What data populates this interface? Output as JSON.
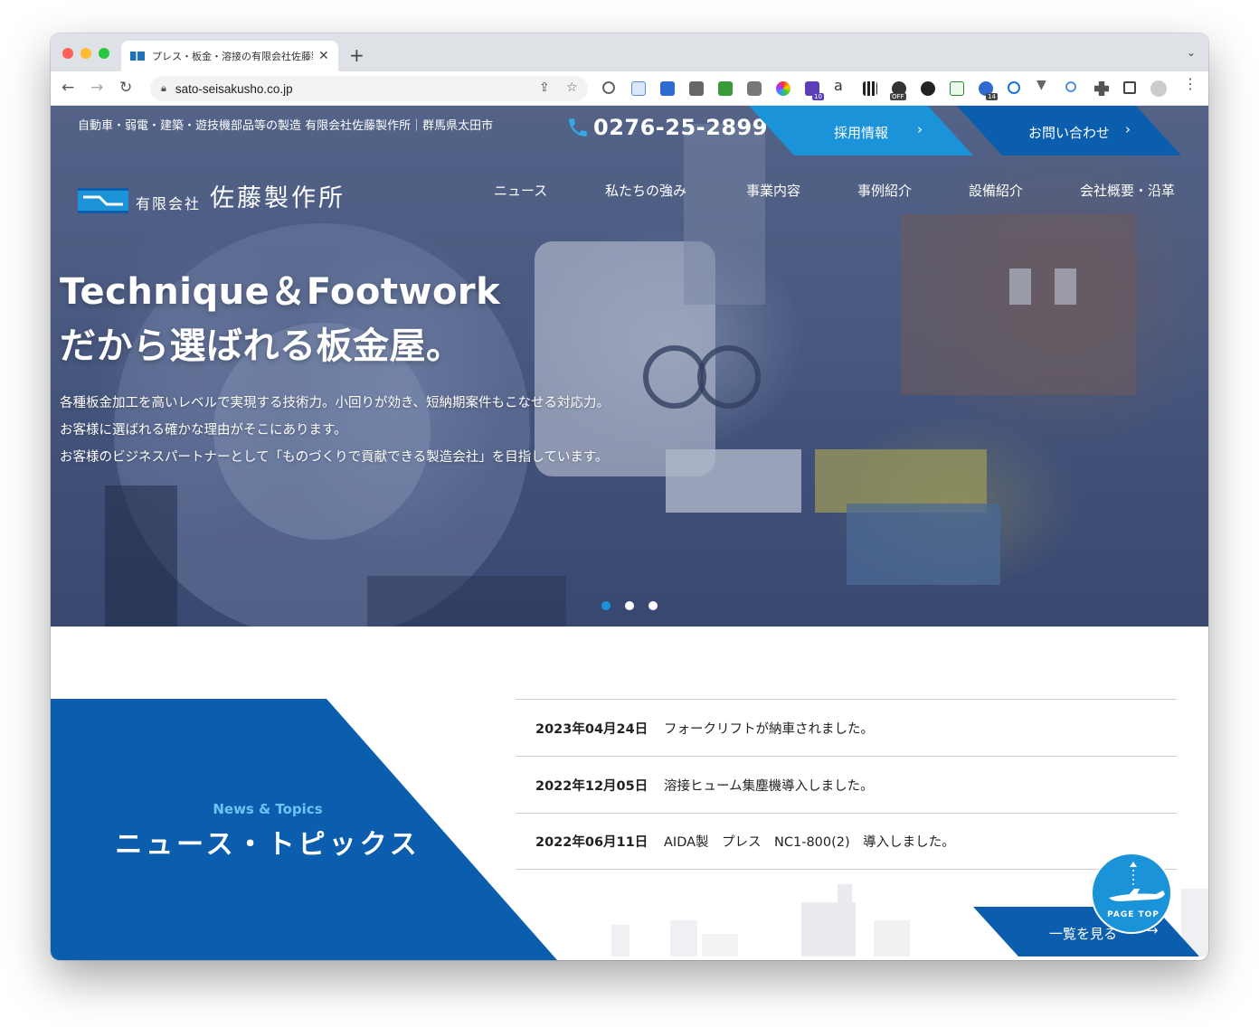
{
  "browser": {
    "tab_title": "プレス・板金・溶接の有限会社佐藤製作所",
    "url": "sato-seisakusho.co.jp",
    "extension_badges": {
      "mail": "10",
      "off": "OFF",
      "sync": "14"
    }
  },
  "header": {
    "info": "自動車・弱電・建築・遊技機部品等の製造 有限会社佐藤製作所｜群馬県太田市",
    "phone": "0276-25-2899",
    "recruit_label": "採用情報",
    "contact_label": "お問い合わせ",
    "logo_prefix": "有限会社",
    "logo_name": "佐藤製作所"
  },
  "nav": [
    "ニュース",
    "私たちの強み",
    "事業内容",
    "事例紹介",
    "設備紹介",
    "会社概要・沿革"
  ],
  "hero": {
    "title_line1": "Technique＆Footwork",
    "title_line2": "だから選ばれる板金屋。",
    "body": [
      "各種板金加工を高いレベルで実現する技術力。小回りが効き、短納期案件もこなせる対応力。",
      "お客様に選ばれる確かな理由がそこにあります。",
      "お客様のビジネスパートナーとして「ものづくりで貢献できる製造会社」を目指しています。"
    ],
    "slider": {
      "count": 3,
      "active_index": 0
    }
  },
  "news": {
    "label_en": "News & Topics",
    "label_ja": "ニュース・トピックス",
    "items": [
      {
        "date": "2023年04月24日",
        "title": "フォークリフトが納車されました。"
      },
      {
        "date": "2022年12月05日",
        "title": "溶接ヒューム集塵機導入しました。"
      },
      {
        "date": "2022年06月11日",
        "title": "AIDA製　プレス　NC1-800(2)　導入しました。"
      }
    ],
    "more_label": "一覧を見る"
  },
  "page_top": "PAGE TOP",
  "colors": {
    "accent": "#1a93d8",
    "brand": "#0b5ead"
  }
}
